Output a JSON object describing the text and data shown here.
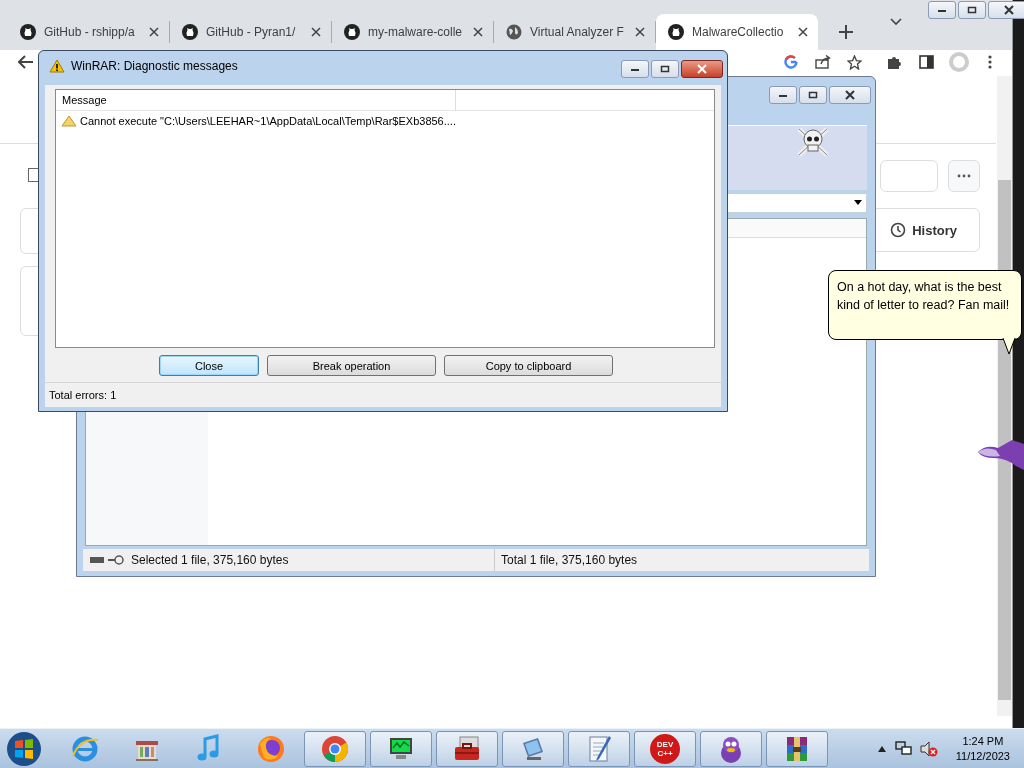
{
  "browser": {
    "tabs": [
      {
        "title": "GitHub - rshipp/a",
        "selected": false
      },
      {
        "title": "GitHub - Pyran1/",
        "selected": false
      },
      {
        "title": "my-malware-colle",
        "selected": false
      },
      {
        "title": "Virtual Analyzer F",
        "selected": false
      },
      {
        "title": "MalwareCollectio",
        "selected": true
      }
    ],
    "page": {
      "history_button": "History"
    }
  },
  "winrar_window": {
    "status_left": "Selected 1 file, 375,160 bytes",
    "status_right": "Total 1 file, 375,160 bytes"
  },
  "dialog": {
    "title": "WinRAR: Diagnostic messages",
    "columns": [
      "Message"
    ],
    "messages": [
      {
        "text": "Cannot execute \"C:\\Users\\LEEHAR~1\\AppData\\Local\\Temp\\Rar$EXb3856...."
      }
    ],
    "buttons": [
      {
        "label": "Close",
        "default": true
      },
      {
        "label": "Break operation",
        "default": false
      },
      {
        "label": "Copy to clipboard",
        "default": false
      }
    ],
    "status": "Total errors: 1"
  },
  "assistant": {
    "speech": "On a hot day, what is the best kind of letter to read? Fan mail!"
  },
  "taskbar": {
    "items": [
      {
        "kind": "ie",
        "running": false
      },
      {
        "kind": "library",
        "running": false
      },
      {
        "kind": "music",
        "running": false
      },
      {
        "kind": "firefox",
        "running": false
      },
      {
        "kind": "chrome",
        "running": true
      },
      {
        "kind": "monitor",
        "running": true
      },
      {
        "kind": "toolbox",
        "running": true
      },
      {
        "kind": "network",
        "running": true
      },
      {
        "kind": "notepad",
        "running": true
      },
      {
        "kind": "devcpp",
        "running": true,
        "badge": [
          "DEV",
          "C++"
        ]
      },
      {
        "kind": "creature",
        "running": true
      },
      {
        "kind": "winrar",
        "running": true
      }
    ],
    "time": "1:24 PM",
    "date": "11/12/2023"
  }
}
